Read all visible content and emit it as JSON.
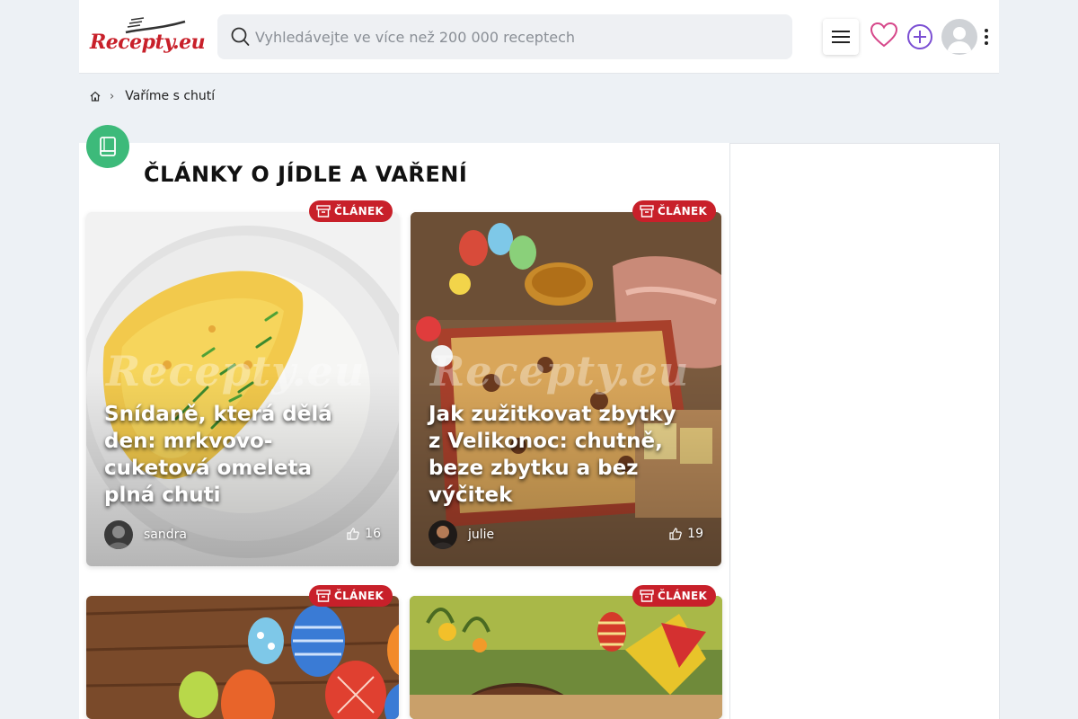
{
  "header": {
    "logo_text": "Recepty.eu",
    "search_placeholder": "Vyhledávejte ve více než 200 000 receptech"
  },
  "breadcrumb": {
    "current": "Vaříme s chutí"
  },
  "section": {
    "title": "ČLÁNKY O JÍDLE A VAŘENÍ"
  },
  "badge_label": "ČLÁNEK",
  "watermark": "Recepty.eu",
  "cards": [
    {
      "title": "Snídaně, která dělá den: mrkvovo-cuketová omeleta plná chuti",
      "author": "sandra",
      "likes": "16"
    },
    {
      "title": "Jak zužitkovat zbytky z Velikonoc: chutně, beze zbytku a bez výčitek",
      "author": "julie",
      "likes": "19"
    },
    {
      "title": "",
      "author": "",
      "likes": ""
    },
    {
      "title": "",
      "author": "",
      "likes": ""
    }
  ],
  "colors": {
    "brand_red": "#c8202a",
    "section_green": "#3dba7a",
    "plus_purple": "#7b4fd3",
    "heart_pink": "#d6478a"
  }
}
